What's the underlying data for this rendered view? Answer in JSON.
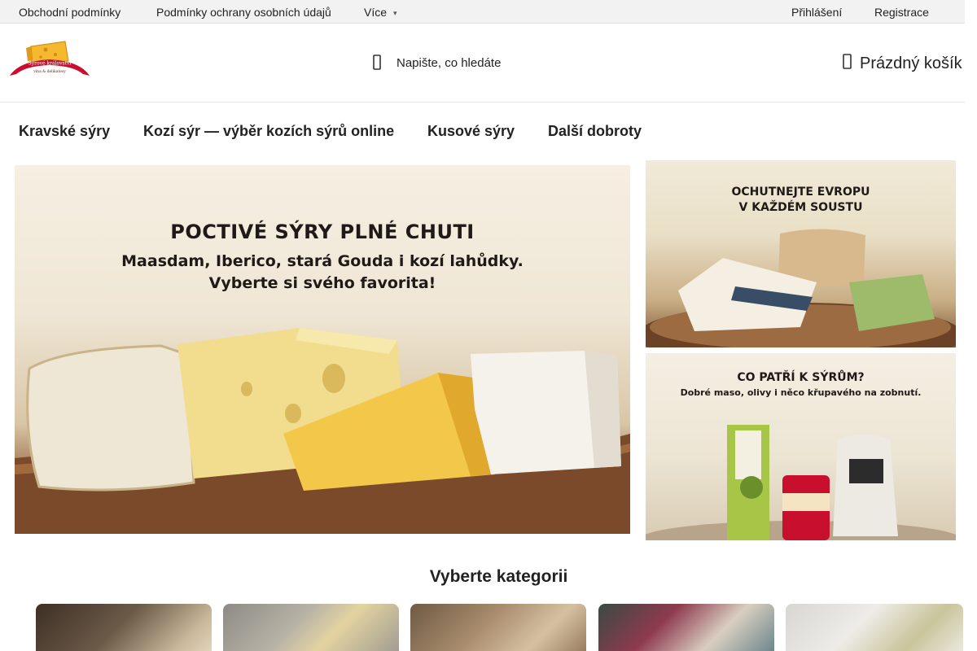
{
  "topbar": {
    "links": [
      "Obchodní podmínky",
      "Podmínky ochrany osobních údajů",
      "Více"
    ],
    "login": "Přihlášení",
    "register": "Registrace"
  },
  "header": {
    "logo_text_top": "Sýrové království",
    "logo_text_bottom": "vína & delikatesy",
    "search_placeholder": "Napište, co hledáte",
    "cart_label": "Prázdný košík"
  },
  "nav": {
    "items": [
      "Kravské sýry",
      "Kozí sýr — výběr kozích sýrů online",
      "Kusové sýry",
      "Další dobroty"
    ]
  },
  "banners": {
    "main": {
      "title": "POCTIVÉ SÝRY PLNÉ CHUTI",
      "subtitle_line1": "Maasdam, Iberico, stará Gouda i kozí lahůdky.",
      "subtitle_line2": "Vyberte si svého favorita!"
    },
    "top": {
      "title_line1": "OCHUTNEJTE EVROPU",
      "title_line2": "V KAŽDÉM SOUSTU"
    },
    "bottom": {
      "title": "CO PATŘÍ K SÝRŮM?",
      "subtitle": "Dobré maso, olivy i něco křupavého na zobnutí."
    }
  },
  "categories": {
    "title": "Vyberte kategorii"
  },
  "colors": {
    "logo_cheese": "#f5b82e",
    "logo_red": "#c8102e",
    "topbar_bg": "#f2f2f2",
    "text": "#222222"
  }
}
